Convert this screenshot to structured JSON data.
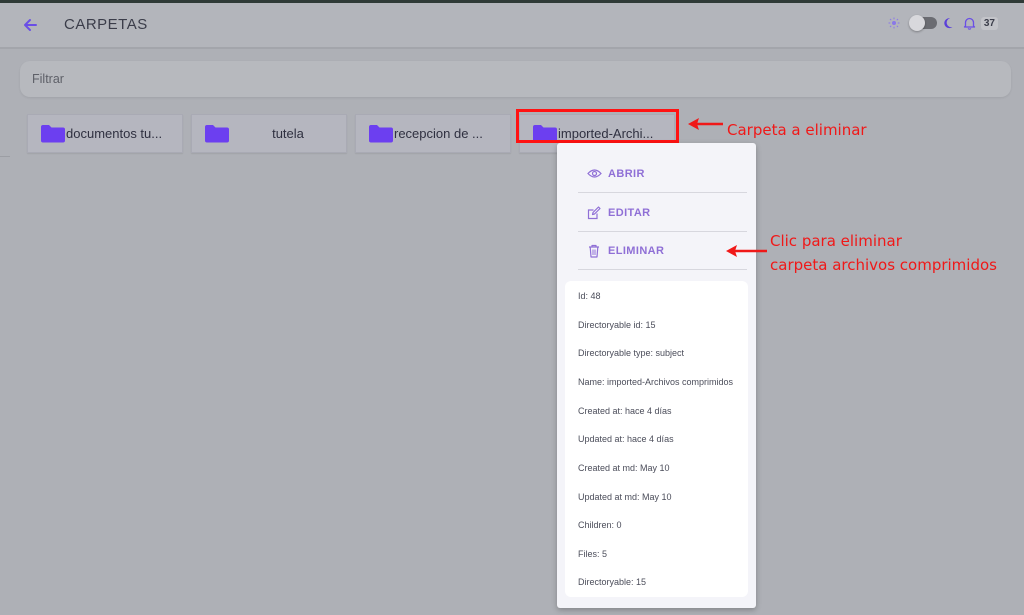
{
  "header": {
    "title": "CARPETAS",
    "notification_count": "37"
  },
  "filter": {
    "placeholder": "Filtrar"
  },
  "folders": [
    {
      "label": "documentos tu..."
    },
    {
      "label": "tutela"
    },
    {
      "label": "recepcion de ..."
    },
    {
      "label": "imported-Archi..."
    }
  ],
  "context_menu": {
    "items": [
      {
        "label": "ABRIR",
        "icon": "eye-icon"
      },
      {
        "label": "EDITAR",
        "icon": "edit-icon"
      },
      {
        "label": "ELIMINAR",
        "icon": "trash-icon"
      }
    ],
    "details": [
      "Id: 48",
      "Directoryable id: 15",
      "Directoryable type: subject",
      "Name: imported-Archivos comprimidos",
      "Created at: hace 4 días",
      "Updated at: hace 4 días",
      "Created at md: May 10",
      "Updated at md: May 10",
      "Children: 0",
      "Files: 5",
      "Directoryable: 15"
    ]
  },
  "annotations": {
    "folder_note": "Carpeta a eliminar",
    "delete_note_line1": "Clic para eliminar",
    "delete_note_line2": "carpeta archivos comprimidos"
  },
  "colors": {
    "accent": "#7c4dff",
    "folder_icon": "#6c3ff0",
    "menu_text": "#8f6fd6",
    "annotation": "#f01818"
  }
}
